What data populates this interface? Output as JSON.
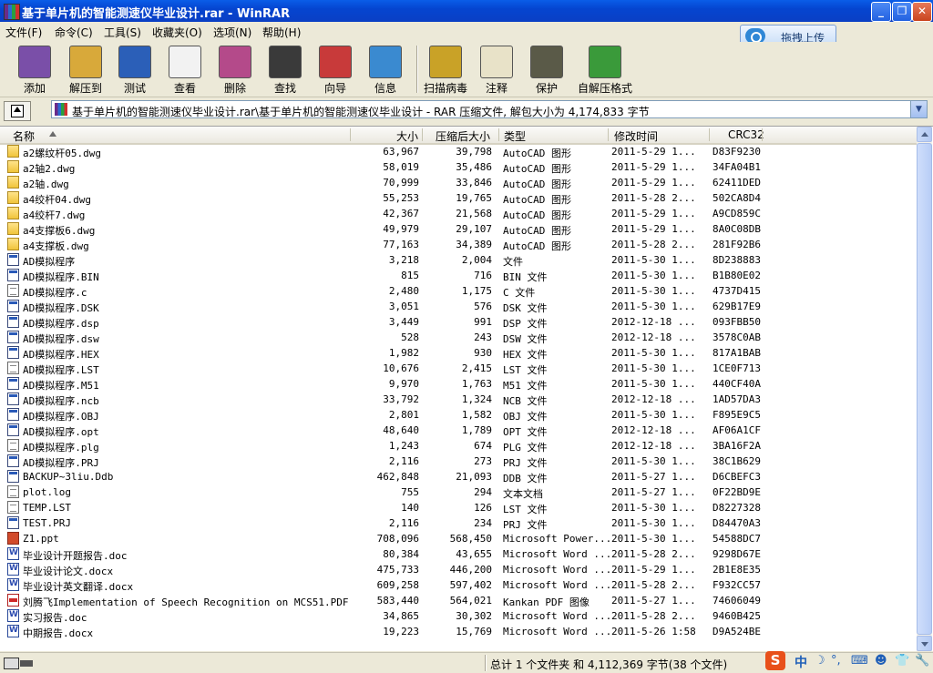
{
  "window": {
    "title": "基于单片机的智能测速仪毕业设计.rar - WinRAR",
    "minimize_glyph": "_",
    "maximize_glyph": "❐",
    "close_glyph": "✕"
  },
  "menu": [
    "文件(F)",
    "命令(C)",
    "工具(S)",
    "收藏夹(O)",
    "选项(N)",
    "帮助(H)"
  ],
  "upload_button": "拖拽上传",
  "toolbar": [
    {
      "label": "添加",
      "icon": "add-archive-icon",
      "color": "#7a4fa8"
    },
    {
      "label": "解压到",
      "icon": "extract-to-icon",
      "color": "#d8a93a"
    },
    {
      "label": "测试",
      "icon": "test-archive-icon",
      "color": "#2b5fb8"
    },
    {
      "label": "查看",
      "icon": "view-glasses-icon",
      "color": "#f2f2f2"
    },
    {
      "label": "删除",
      "icon": "delete-icon",
      "color": "#b44a8a"
    },
    {
      "label": "查找",
      "icon": "find-binoculars-icon",
      "color": "#3a3a3a"
    },
    {
      "label": "向导",
      "icon": "wizard-icon",
      "color": "#c83a3a"
    },
    {
      "label": "信息",
      "icon": "info-icon",
      "color": "#3a8ad0"
    },
    {
      "label": "扫描病毒",
      "icon": "virus-scan-icon",
      "color": "#c9a227"
    },
    {
      "label": "注释",
      "icon": "comment-icon",
      "color": "#e8e2c8"
    },
    {
      "label": "保护",
      "icon": "protect-shield-icon",
      "color": "#5a5a48"
    },
    {
      "label": "自解压格式",
      "icon": "sfx-icon",
      "color": "#3a9a3a"
    }
  ],
  "address": {
    "path": "基于单片机的智能测速仪毕业设计.rar\\基于单片机的智能测速仪毕业设计 - RAR 压缩文件, 解包大小为 4,174,833 字节",
    "dropdown_glyph": "▼"
  },
  "columns": {
    "name": "名称",
    "size": "大小",
    "packed": "压缩后大小",
    "type": "类型",
    "modified": "修改时间",
    "crc": "CRC32"
  },
  "files": [
    {
      "icon": "dwg",
      "name": "a2螺纹杆05.dwg",
      "size": "63,967",
      "packed": "39,798",
      "type": "AutoCAD 图形",
      "modified": "2011-5-29 1...",
      "crc": "D83F9230"
    },
    {
      "icon": "dwg",
      "name": "a2轴2.dwg",
      "size": "58,019",
      "packed": "35,486",
      "type": "AutoCAD 图形",
      "modified": "2011-5-29 1...",
      "crc": "34FA04B1"
    },
    {
      "icon": "dwg",
      "name": "a2轴.dwg",
      "size": "70,999",
      "packed": "33,846",
      "type": "AutoCAD 图形",
      "modified": "2011-5-29 1...",
      "crc": "62411DED"
    },
    {
      "icon": "dwg",
      "name": "a4绞杆04.dwg",
      "size": "55,253",
      "packed": "19,765",
      "type": "AutoCAD 图形",
      "modified": "2011-5-28 2...",
      "crc": "502CA8D4"
    },
    {
      "icon": "dwg",
      "name": "a4绞杆7.dwg",
      "size": "42,367",
      "packed": "21,568",
      "type": "AutoCAD 图形",
      "modified": "2011-5-29 1...",
      "crc": "A9CD859C"
    },
    {
      "icon": "dwg",
      "name": "a4支撑板6.dwg",
      "size": "49,979",
      "packed": "29,107",
      "type": "AutoCAD 图形",
      "modified": "2011-5-29 1...",
      "crc": "8A0C08DB"
    },
    {
      "icon": "dwg",
      "name": "a4支撑板.dwg",
      "size": "77,163",
      "packed": "34,389",
      "type": "AutoCAD 图形",
      "modified": "2011-5-28 2...",
      "crc": "281F92B6"
    },
    {
      "icon": "exe",
      "name": "AD模拟程序",
      "size": "3,218",
      "packed": "2,004",
      "type": "文件",
      "modified": "2011-5-30 1...",
      "crc": "8D238883"
    },
    {
      "icon": "exe",
      "name": "AD模拟程序.BIN",
      "size": "815",
      "packed": "716",
      "type": "BIN 文件",
      "modified": "2011-5-30 1...",
      "crc": "B1B80E02"
    },
    {
      "icon": "txt",
      "name": "AD模拟程序.c",
      "size": "2,480",
      "packed": "1,175",
      "type": "C 文件",
      "modified": "2011-5-30 1...",
      "crc": "4737D415"
    },
    {
      "icon": "exe",
      "name": "AD模拟程序.DSK",
      "size": "3,051",
      "packed": "576",
      "type": "DSK 文件",
      "modified": "2011-5-30 1...",
      "crc": "629B17E9"
    },
    {
      "icon": "exe",
      "name": "AD模拟程序.dsp",
      "size": "3,449",
      "packed": "991",
      "type": "DSP 文件",
      "modified": "2012-12-18 ...",
      "crc": "093FBB50"
    },
    {
      "icon": "exe",
      "name": "AD模拟程序.dsw",
      "size": "528",
      "packed": "243",
      "type": "DSW 文件",
      "modified": "2012-12-18 ...",
      "crc": "3578C0AB"
    },
    {
      "icon": "exe",
      "name": "AD模拟程序.HEX",
      "size": "1,982",
      "packed": "930",
      "type": "HEX 文件",
      "modified": "2011-5-30 1...",
      "crc": "817A1BAB"
    },
    {
      "icon": "txt",
      "name": "AD模拟程序.LST",
      "size": "10,676",
      "packed": "2,415",
      "type": "LST 文件",
      "modified": "2011-5-30 1...",
      "crc": "1CE0F713"
    },
    {
      "icon": "exe",
      "name": "AD模拟程序.M51",
      "size": "9,970",
      "packed": "1,763",
      "type": "M51 文件",
      "modified": "2011-5-30 1...",
      "crc": "440CF40A"
    },
    {
      "icon": "exe",
      "name": "AD模拟程序.ncb",
      "size": "33,792",
      "packed": "1,324",
      "type": "NCB 文件",
      "modified": "2012-12-18 ...",
      "crc": "1AD57DA3"
    },
    {
      "icon": "exe",
      "name": "AD模拟程序.OBJ",
      "size": "2,801",
      "packed": "1,582",
      "type": "OBJ 文件",
      "modified": "2011-5-30 1...",
      "crc": "F895E9C5"
    },
    {
      "icon": "exe",
      "name": "AD模拟程序.opt",
      "size": "48,640",
      "packed": "1,789",
      "type": "OPT 文件",
      "modified": "2012-12-18 ...",
      "crc": "AF06A1CF"
    },
    {
      "icon": "txt",
      "name": "AD模拟程序.plg",
      "size": "1,243",
      "packed": "674",
      "type": "PLG 文件",
      "modified": "2012-12-18 ...",
      "crc": "3BA16F2A"
    },
    {
      "icon": "exe",
      "name": "AD模拟程序.PRJ",
      "size": "2,116",
      "packed": "273",
      "type": "PRJ 文件",
      "modified": "2011-5-30 1...",
      "crc": "38C1B629"
    },
    {
      "icon": "exe",
      "name": "BACKUP~3liu.Ddb",
      "size": "462,848",
      "packed": "21,093",
      "type": "DDB 文件",
      "modified": "2011-5-27 1...",
      "crc": "D6CBEFC3"
    },
    {
      "icon": "txt",
      "name": "plot.log",
      "size": "755",
      "packed": "294",
      "type": "文本文档",
      "modified": "2011-5-27 1...",
      "crc": "0F22BD9E"
    },
    {
      "icon": "txt",
      "name": "TEMP.LST",
      "size": "140",
      "packed": "126",
      "type": "LST 文件",
      "modified": "2011-5-30 1...",
      "crc": "D8227328"
    },
    {
      "icon": "exe",
      "name": "TEST.PRJ",
      "size": "2,116",
      "packed": "234",
      "type": "PRJ 文件",
      "modified": "2011-5-30 1...",
      "crc": "D84470A3"
    },
    {
      "icon": "ppt",
      "name": "Z1.ppt",
      "size": "708,096",
      "packed": "568,450",
      "type": "Microsoft Power...",
      "modified": "2011-5-30 1...",
      "crc": "54588DC7"
    },
    {
      "icon": "word",
      "name": "毕业设计开题报告.doc",
      "size": "80,384",
      "packed": "43,655",
      "type": "Microsoft Word ...",
      "modified": "2011-5-28 2...",
      "crc": "9298D67E"
    },
    {
      "icon": "word",
      "name": "毕业设计论文.docx",
      "size": "475,733",
      "packed": "446,200",
      "type": "Microsoft Word ...",
      "modified": "2011-5-29 1...",
      "crc": "2B1E8E35"
    },
    {
      "icon": "word",
      "name": "毕业设计英文翻译.docx",
      "size": "609,258",
      "packed": "597,402",
      "type": "Microsoft Word ...",
      "modified": "2011-5-28 2...",
      "crc": "F932CC57"
    },
    {
      "icon": "pdf",
      "name": "刘腾飞Implementation of Speech Recognition on MCS51.PDF",
      "size": "583,440",
      "packed": "564,021",
      "type": "Kankan PDF 图像",
      "modified": "2011-5-27 1...",
      "crc": "74606049"
    },
    {
      "icon": "word",
      "name": "实习报告.doc",
      "size": "34,865",
      "packed": "30,302",
      "type": "Microsoft Word ...",
      "modified": "2011-5-28 2...",
      "crc": "9460B425"
    },
    {
      "icon": "word",
      "name": "中期报告.docx",
      "size": "19,223",
      "packed": "15,769",
      "type": "Microsoft Word ...",
      "modified": "2011-5-26 1:58",
      "crc": "D9A524BE"
    }
  ],
  "status": "总计 1 个文件夹 和 4,112,369 字节(38 个文件)",
  "ime": {
    "logo": "S",
    "mode": "中",
    "moon": "☽",
    "punct": "°,",
    "keyboard": "⌨",
    "user": "☻",
    "shirt": "👕",
    "wrench": "🔧"
  }
}
